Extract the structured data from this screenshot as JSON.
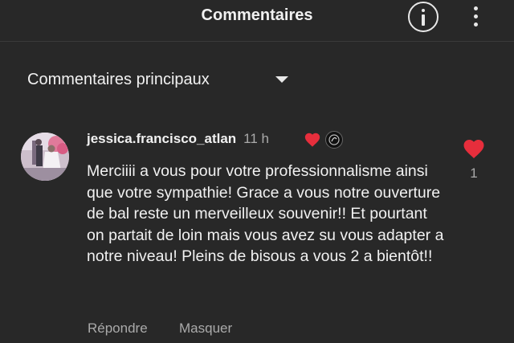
{
  "header": {
    "title": "Commentaires",
    "info_icon": "info-icon",
    "more_icon": "more-vert-icon"
  },
  "sort": {
    "label": "Commentaires principaux",
    "caret_icon": "dropdown-caret-icon"
  },
  "comment": {
    "author": "jessica.francisco_atlan",
    "time": "11 h",
    "creator_heart_icon": "heart-icon",
    "creator_badge_icon": "creator-avatar-icon",
    "text": "Merciiii a vous pour votre professionnalisme ainsi que votre sympathie! Grace a vous notre ouverture de bal reste un merveilleux souvenir!! Et pourtant on partait de loin mais vous avez su vous adapter a notre niveau! Pleins de bisous a vous 2 a bientôt!!",
    "actions": {
      "reply": "Répondre",
      "hide": "Masquer"
    },
    "like_count": "1",
    "like_icon": "heart-icon"
  },
  "colors": {
    "background": "#282828",
    "text_primary": "#f1f1f1",
    "text_secondary": "#aaaaaa",
    "heart_red": "#e62e3c"
  }
}
